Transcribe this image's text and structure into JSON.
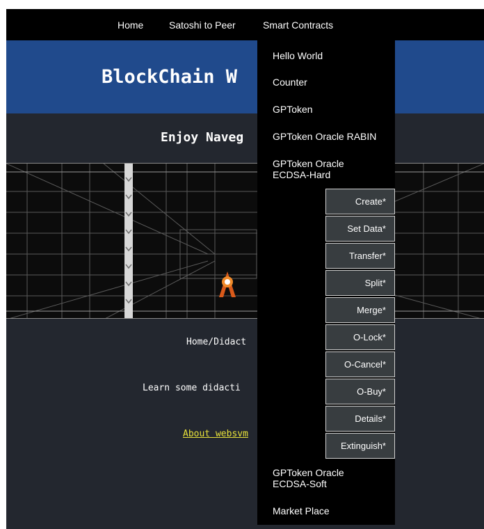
{
  "nav": {
    "items": [
      "Home",
      "Satoshi to Peer",
      "Smart Contracts"
    ]
  },
  "banner": {
    "title": "BlockChain W"
  },
  "subtitle": "Enjoy Naveg",
  "content": {
    "breadcrumb": "Home/Didact",
    "intro": "Learn some didacti",
    "about_link": "About websvm"
  },
  "dropdown": {
    "items": [
      "Hello World",
      "Counter",
      "GPToken",
      "GPToken Oracle RABIN",
      "GPToken Oracle ECDSA-Hard",
      "GPToken Oracle ECDSA-Soft",
      "Market Place"
    ],
    "submenu": [
      "Create*",
      "Set Data*",
      "Transfer*",
      "Split*",
      "Merge*",
      "O-Lock*",
      "O-Cancel*",
      "O-Buy*",
      "Details*",
      "Extinguish*"
    ]
  },
  "colors": {
    "nav_bg": "#000000",
    "banner_bg": "#204a8c",
    "page_bg": "#23272f",
    "link": "#e8e23a",
    "submenu_bg": "#383d40"
  }
}
